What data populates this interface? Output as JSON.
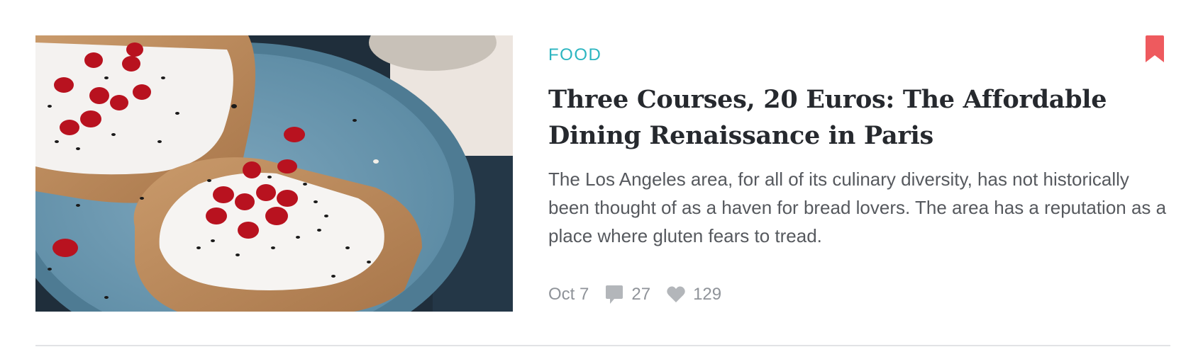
{
  "article": {
    "category": "FOOD",
    "title": "Three Courses, 20 Euros: The Affordable Dining Renaissance in Paris",
    "excerpt": "The Los Angeles area, for all of its culinary diversity, has not historically been thought of as a haven for bread lovers. The area has a reputation as a place where gluten fears to tread.",
    "date": "Oct 7",
    "comments": "27",
    "likes": "129"
  },
  "colors": {
    "category": "#2bb5c0",
    "bookmark": "#ee5a5e",
    "title": "#26292e",
    "excerpt": "#56595e",
    "meta": "#8f9399"
  },
  "icons": {
    "bookmark": "bookmark-icon",
    "comments": "comment-icon",
    "likes": "heart-icon"
  }
}
